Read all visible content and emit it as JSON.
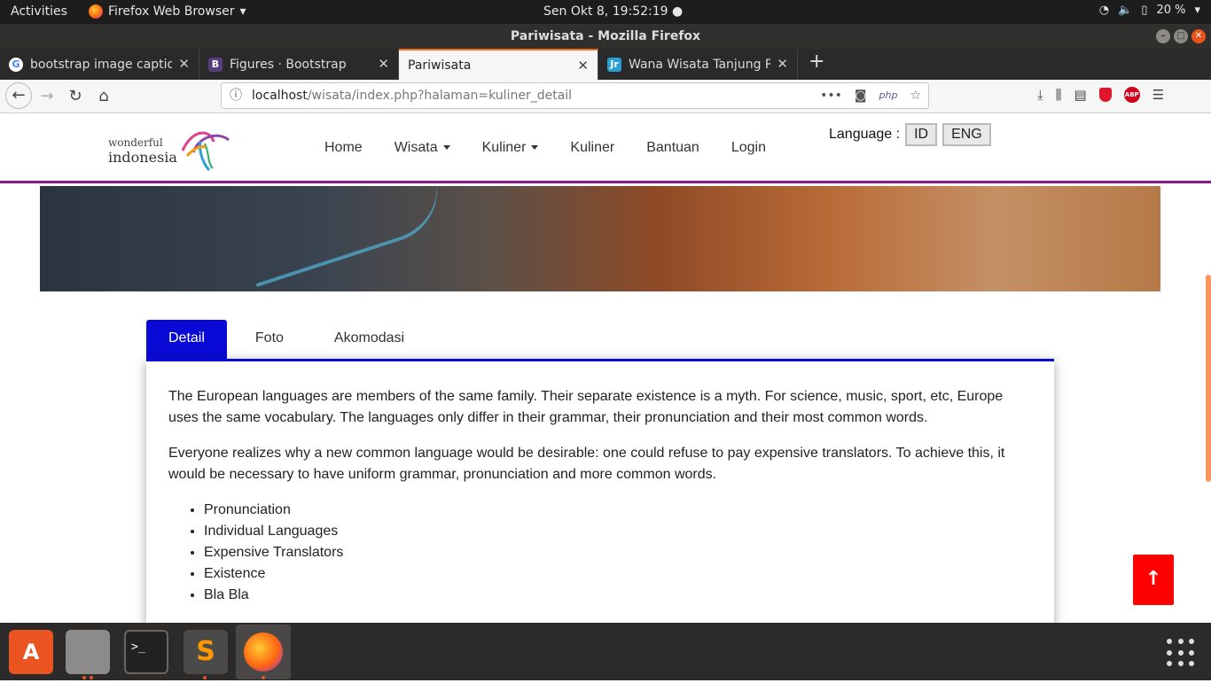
{
  "system": {
    "activities": "Activities",
    "app_name": "Firefox Web Browser",
    "clock": "Sen Okt  8, 19:52:19",
    "battery": "20 %"
  },
  "window": {
    "title": "Pariwisata - Mozilla Firefox"
  },
  "tabs": [
    {
      "label": "bootstrap image caption",
      "icon": "G",
      "color": "#4285f4"
    },
    {
      "label": "Figures · Bootstrap",
      "icon": "B",
      "color": "#563d7c"
    },
    {
      "label": "Pariwisata",
      "icon": "",
      "color": ""
    },
    {
      "label": "Wana Wisata Tanjung Pa",
      "icon": "Jr",
      "color": "#2a9fd6"
    }
  ],
  "url": {
    "host": "localhost",
    "path": "/wisata/index.php?halaman=kuliner_detail",
    "php_badge": "php"
  },
  "site": {
    "logo_line1": "wonderful",
    "logo_line2": "indonesia",
    "menu": [
      "Home",
      "Wisata",
      "Kuliner",
      "Kuliner",
      "Bantuan",
      "Login"
    ],
    "language_label": "Language :",
    "lang_id": "ID",
    "lang_eng": "ENG"
  },
  "content": {
    "tabs": [
      "Detail",
      "Foto",
      "Akomodasi"
    ],
    "paragraph1": "The European languages are members of the same family. Their separate existence is a myth. For science, music, sport, etc, Europe uses the same vocabulary. The languages only differ in their grammar, their pronunciation and their most common words.",
    "paragraph2": "Everyone realizes why a new common language would be desirable: one could refuse to pay expensive translators. To achieve this, it would be necessary to have uniform grammar, pronunciation and more common words.",
    "list": [
      "Pronunciation",
      "Individual Languages",
      "Expensive Translators",
      "Existence",
      "Bla Bla"
    ],
    "to_top": "↑"
  },
  "icons": {
    "back": "back-arrow-icon",
    "forward": "forward-arrow-icon",
    "reload": "reload-icon",
    "home": "home-icon",
    "wifi": "wifi-icon",
    "volume": "volume-icon",
    "battery": "battery-icon"
  }
}
